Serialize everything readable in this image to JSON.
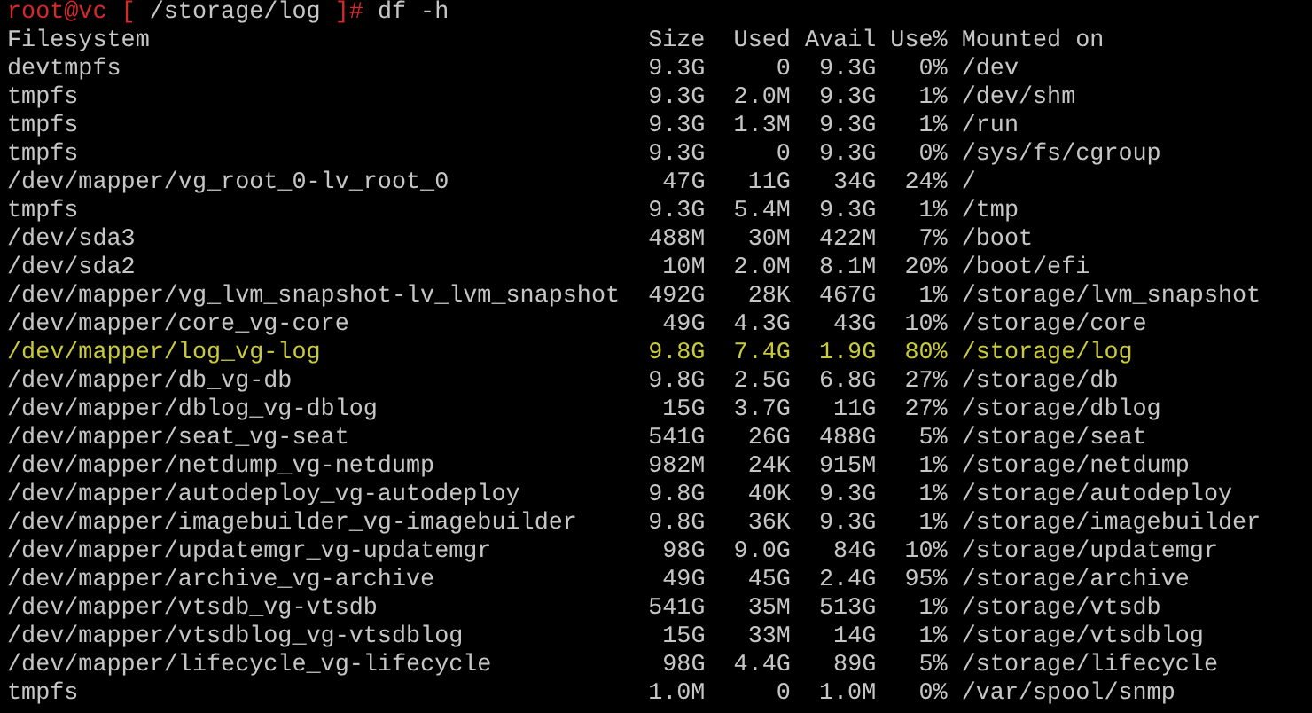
{
  "prompt": {
    "user_host": "root@vc",
    "open_bracket": "[",
    "cwd": "/storage/log",
    "close_bracket": "]#",
    "command": "df -h"
  },
  "table": {
    "columns": [
      "Filesystem",
      "Size",
      "Used",
      "Avail",
      "Use%",
      "Mounted on"
    ],
    "rows": [
      {
        "cells": [
          "devtmpfs",
          "9.3G",
          "0",
          "9.3G",
          "0%",
          "/dev"
        ],
        "highlighted": false
      },
      {
        "cells": [
          "tmpfs",
          "9.3G",
          "2.0M",
          "9.3G",
          "1%",
          "/dev/shm"
        ],
        "highlighted": false
      },
      {
        "cells": [
          "tmpfs",
          "9.3G",
          "1.3M",
          "9.3G",
          "1%",
          "/run"
        ],
        "highlighted": false
      },
      {
        "cells": [
          "tmpfs",
          "9.3G",
          "0",
          "9.3G",
          "0%",
          "/sys/fs/cgroup"
        ],
        "highlighted": false
      },
      {
        "cells": [
          "/dev/mapper/vg_root_0-lv_root_0",
          "47G",
          "11G",
          "34G",
          "24%",
          "/"
        ],
        "highlighted": false
      },
      {
        "cells": [
          "tmpfs",
          "9.3G",
          "5.4M",
          "9.3G",
          "1%",
          "/tmp"
        ],
        "highlighted": false
      },
      {
        "cells": [
          "/dev/sda3",
          "488M",
          "30M",
          "422M",
          "7%",
          "/boot"
        ],
        "highlighted": false
      },
      {
        "cells": [
          "/dev/sda2",
          "10M",
          "2.0M",
          "8.1M",
          "20%",
          "/boot/efi"
        ],
        "highlighted": false
      },
      {
        "cells": [
          "/dev/mapper/vg_lvm_snapshot-lv_lvm_snapshot",
          "492G",
          "28K",
          "467G",
          "1%",
          "/storage/lvm_snapshot"
        ],
        "highlighted": false
      },
      {
        "cells": [
          "/dev/mapper/core_vg-core",
          "49G",
          "4.3G",
          "43G",
          "10%",
          "/storage/core"
        ],
        "highlighted": false
      },
      {
        "cells": [
          "/dev/mapper/log_vg-log",
          "9.8G",
          "7.4G",
          "1.9G",
          "80%",
          "/storage/log"
        ],
        "highlighted": true
      },
      {
        "cells": [
          "/dev/mapper/db_vg-db",
          "9.8G",
          "2.5G",
          "6.8G",
          "27%",
          "/storage/db"
        ],
        "highlighted": false
      },
      {
        "cells": [
          "/dev/mapper/dblog_vg-dblog",
          "15G",
          "3.7G",
          "11G",
          "27%",
          "/storage/dblog"
        ],
        "highlighted": false
      },
      {
        "cells": [
          "/dev/mapper/seat_vg-seat",
          "541G",
          "26G",
          "488G",
          "5%",
          "/storage/seat"
        ],
        "highlighted": false
      },
      {
        "cells": [
          "/dev/mapper/netdump_vg-netdump",
          "982M",
          "24K",
          "915M",
          "1%",
          "/storage/netdump"
        ],
        "highlighted": false
      },
      {
        "cells": [
          "/dev/mapper/autodeploy_vg-autodeploy",
          "9.8G",
          "40K",
          "9.3G",
          "1%",
          "/storage/autodeploy"
        ],
        "highlighted": false
      },
      {
        "cells": [
          "/dev/mapper/imagebuilder_vg-imagebuilder",
          "9.8G",
          "36K",
          "9.3G",
          "1%",
          "/storage/imagebuilder"
        ],
        "highlighted": false
      },
      {
        "cells": [
          "/dev/mapper/updatemgr_vg-updatemgr",
          "98G",
          "9.0G",
          "84G",
          "10%",
          "/storage/updatemgr"
        ],
        "highlighted": false
      },
      {
        "cells": [
          "/dev/mapper/archive_vg-archive",
          "49G",
          "45G",
          "2.4G",
          "95%",
          "/storage/archive"
        ],
        "highlighted": false
      },
      {
        "cells": [
          "/dev/mapper/vtsdb_vg-vtsdb",
          "541G",
          "35M",
          "513G",
          "1%",
          "/storage/vtsdb"
        ],
        "highlighted": false
      },
      {
        "cells": [
          "/dev/mapper/vtsdblog_vg-vtsdblog",
          "15G",
          "33M",
          "14G",
          "1%",
          "/storage/vtsdblog"
        ],
        "highlighted": false
      },
      {
        "cells": [
          "/dev/mapper/lifecycle_vg-lifecycle",
          "98G",
          "4.4G",
          "89G",
          "5%",
          "/storage/lifecycle"
        ],
        "highlighted": false
      },
      {
        "cells": [
          "tmpfs",
          "1.0M",
          "0",
          "1.0M",
          "0%",
          "/var/spool/snmp"
        ],
        "highlighted": false
      }
    ]
  }
}
